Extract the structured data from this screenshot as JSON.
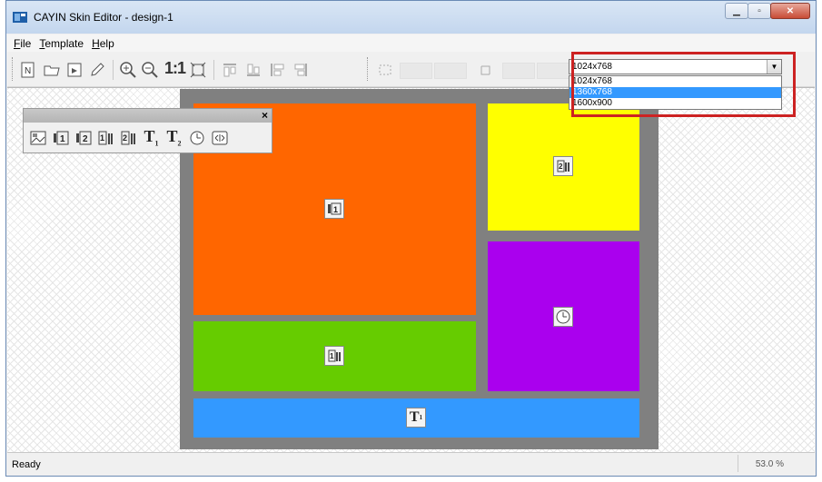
{
  "window": {
    "title": "CAYIN Skin Editor - design-1"
  },
  "menu": {
    "file": "File",
    "template": "Template",
    "help": "Help"
  },
  "toolbar": {
    "zoom_actual_label": "1:1",
    "resolution": {
      "selected": "1024x768",
      "options": [
        "1024x768",
        "1360x768",
        "1600x900"
      ],
      "highlighted_option": "1360x768"
    }
  },
  "palette": {
    "close_label": "×"
  },
  "layout_zones": [
    {
      "name": "video-zone-1",
      "color": "#ff6600",
      "icon": "video-1-icon"
    },
    {
      "name": "image-zone-2",
      "color": "#ffff00",
      "icon": "image-2-icon"
    },
    {
      "name": "image-zone-1",
      "color": "#66cc00",
      "icon": "image-1-icon"
    },
    {
      "name": "clock-zone",
      "color": "#aa00ee",
      "icon": "clock-icon"
    },
    {
      "name": "text-zone-1",
      "color": "#3399ff",
      "icon": "text-1-icon"
    }
  ],
  "status": {
    "text": "Ready",
    "zoom": "53.0 %"
  }
}
